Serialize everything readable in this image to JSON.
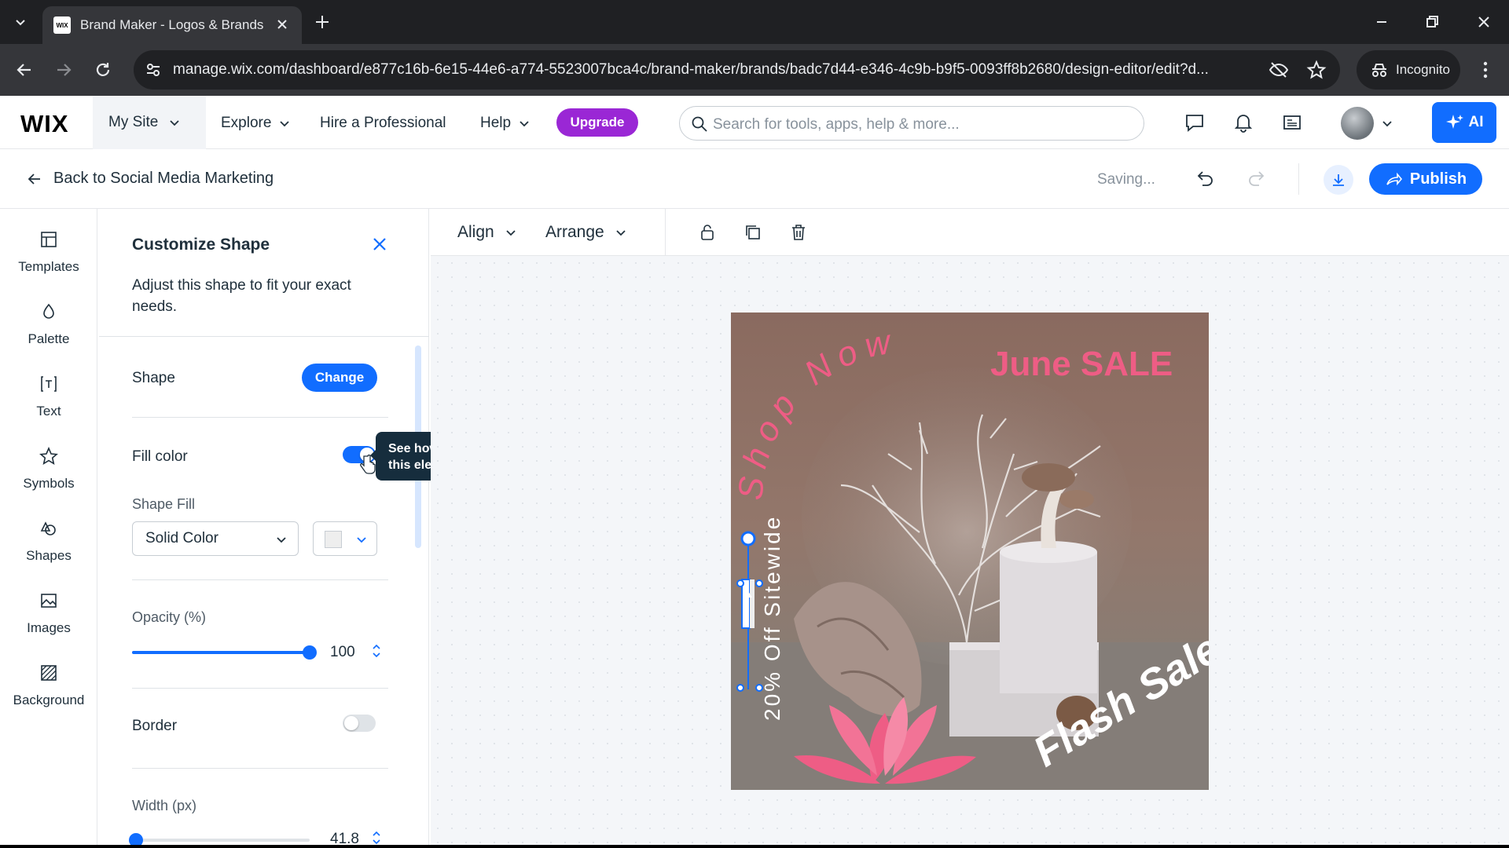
{
  "browser": {
    "tab_title": "Brand Maker - Logos & Brands",
    "favicon_text": "WIX",
    "url": "manage.wix.com/dashboard/e877c16b-6e15-44e6-a774-5523007bca4c/brand-maker/brands/badc7d44-e346-4c9b-b9f5-0093ff8b2680/design-editor/edit?d...",
    "incognito_label": "Incognito"
  },
  "topbar": {
    "logo": "WIX",
    "my_site": "My Site",
    "explore": "Explore",
    "hire": "Hire a Professional",
    "help": "Help",
    "upgrade": "Upgrade",
    "search_placeholder": "Search for tools, apps, help & more...",
    "ai_label": "AI"
  },
  "subbar": {
    "back_label": "Back to Social Media Marketing",
    "status": "Saving...",
    "publish": "Publish"
  },
  "rail": {
    "items": [
      {
        "label": "Templates",
        "icon": "templates-icon"
      },
      {
        "label": "Palette",
        "icon": "palette-icon"
      },
      {
        "label": "Text",
        "icon": "text-icon"
      },
      {
        "label": "Symbols",
        "icon": "star-icon"
      },
      {
        "label": "Shapes",
        "icon": "shapes-icon"
      },
      {
        "label": "Images",
        "icon": "image-icon"
      },
      {
        "label": "Background",
        "icon": "background-icon"
      }
    ]
  },
  "panel": {
    "title": "Customize Shape",
    "description": "Adjust this shape to fit your exact needs.",
    "shape_label": "Shape",
    "change_button": "Change",
    "fill_color_label": "Fill color",
    "fill_color_on": true,
    "shape_fill_label": "Shape Fill",
    "shape_fill_value": "Solid Color",
    "swatch_color": "#eeeeee",
    "opacity_label": "Opacity (%)",
    "opacity_value": "100",
    "opacity_fraction": 1.0,
    "border_label": "Border",
    "border_on": false,
    "width_label": "Width (px)",
    "width_value": "41.8",
    "width_fraction": 0.0
  },
  "tooltip": {
    "text": "See how your logo looks with this element colored in."
  },
  "editor": {
    "align": "Align",
    "arrange": "Arrange"
  },
  "artwork": {
    "shop_now": "Shop Now",
    "june_sale": "June SALE",
    "off_sitewide": "20% Off Sitewide",
    "flash_sale": "Flash Sale"
  },
  "colors": {
    "accent": "#116dff",
    "upgrade": "#9a27d5",
    "pink": "#ef5c86"
  }
}
